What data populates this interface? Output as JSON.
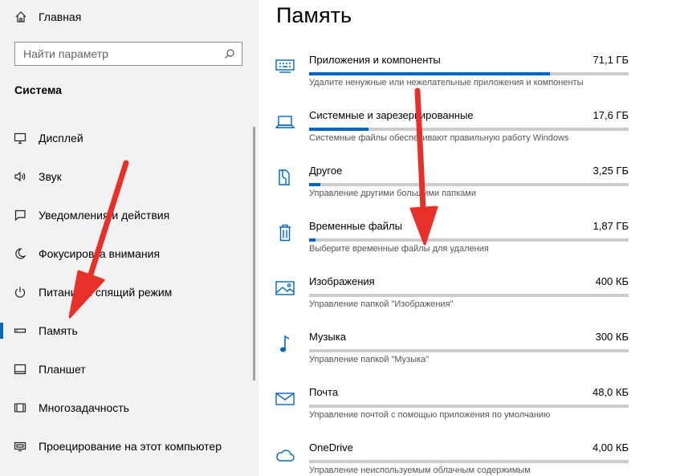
{
  "sidebar": {
    "home_label": "Главная",
    "search_placeholder": "Найти параметр",
    "section_title": "Система",
    "items": [
      {
        "label": "Дисплей",
        "icon": "display-icon"
      },
      {
        "label": "Звук",
        "icon": "speaker-icon"
      },
      {
        "label": "Уведомления и действия",
        "icon": "notification-icon"
      },
      {
        "label": "Фокусировка внимания",
        "icon": "moon-icon"
      },
      {
        "label": "Питание и спящий режим",
        "icon": "power-icon"
      },
      {
        "label": "Память",
        "icon": "storage-icon",
        "active": true
      },
      {
        "label": "Планшет",
        "icon": "tablet-icon"
      },
      {
        "label": "Многозадачность",
        "icon": "multitasking-icon"
      },
      {
        "label": "Проецирование на этот компьютер",
        "icon": "projector-icon"
      }
    ]
  },
  "main": {
    "title": "Память",
    "categories": [
      {
        "name": "Приложения и компоненты",
        "size": "71,1 ГБ",
        "desc": "Удалите ненужные или нежелательные приложения и компоненты",
        "fill": 0.755,
        "icon": "apps-icon"
      },
      {
        "name": "Системные и зарезервированные",
        "size": "17,6 ГБ",
        "desc": "Системные файлы обеспечивают правильную работу Windows",
        "fill": 0.187,
        "icon": "laptop-icon"
      },
      {
        "name": "Другое",
        "size": "3,25 ГБ",
        "desc": "Управление другими большими папками",
        "fill": 0.035,
        "icon": "other-icon"
      },
      {
        "name": "Временные файлы",
        "size": "1,87 ГБ",
        "desc": "Выберите временные файлы для удаления",
        "fill": 0.02,
        "icon": "trash-icon"
      },
      {
        "name": "Изображения",
        "size": "400 КБ",
        "desc": "Управление папкой \"Изображения\"",
        "fill": 0,
        "icon": "image-icon"
      },
      {
        "name": "Музыка",
        "size": "300 КБ",
        "desc": "Управление папкой \"Музыка\"",
        "fill": 0,
        "icon": "music-icon"
      },
      {
        "name": "Почта",
        "size": "48,0 КБ",
        "desc": "Управление почтой с помощью приложения по умолчанию",
        "fill": 0,
        "icon": "mail-icon"
      },
      {
        "name": "OneDrive",
        "size": "4,00 КБ",
        "desc": "Управление неиспользуемым облачным содержимым",
        "fill": 0,
        "icon": "cloud-icon"
      }
    ]
  },
  "colors": {
    "accent": "#0067c0",
    "sidebar_bg": "#f2f2f2",
    "arrow": "#e8302a",
    "bar_track": "#cccccc"
  }
}
